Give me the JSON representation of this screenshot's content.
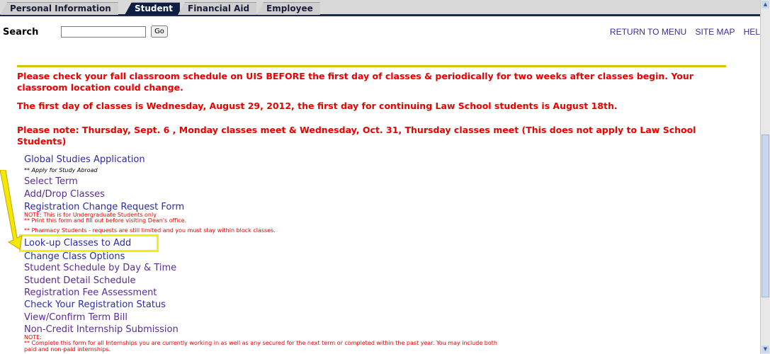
{
  "tabs": [
    {
      "label": "Personal Information",
      "active": false
    },
    {
      "label": "Student",
      "active": true
    },
    {
      "label": "Financial Aid",
      "active": false
    },
    {
      "label": "Employee",
      "active": false
    }
  ],
  "search": {
    "label": "Search",
    "value": "",
    "go_label": "Go"
  },
  "top_links": [
    "RETURN TO MENU",
    "SITE MAP",
    "HELP"
  ],
  "notices": [
    "Please check your fall classroom schedule on UIS BEFORE the first day of classes & periodically for two weeks after classes begin. Your classroom location could change.",
    "The first day of classes is Wednesday, August 29, 2012, the first day for continuing Law School students is August 18th.",
    "Please note: Thursday, Sept. 6 , Monday classes meet & Wednesday, Oct. 31, Thursday classes meet (This does not apply to Law School Students)"
  ],
  "menu": {
    "global_studies": "Global Studies Application",
    "global_studies_note": "** Apply for Study Abroad",
    "select_term": "Select Term",
    "add_drop": "Add/Drop Classes",
    "reg_change": "Registration Change Request Form",
    "reg_change_note1": "NOTE: This is for Undergraduate Students only",
    "reg_change_note2": "** Print this form and fill out before visiting Dean's office.",
    "reg_change_note3": "** Pharmacy Students - requests are still limited and you must stay within block classes.",
    "lookup_classes": "Look-up Classes to Add",
    "change_class_options": "Change Class Options",
    "schedule_day_time": "Student Schedule by Day & Time",
    "detail_schedule": "Student Detail Schedule",
    "fee_assessment": "Registration Fee Assessment",
    "reg_status": "Check Your Registration Status",
    "term_bill": "View/Confirm Term Bill",
    "internship": "Non-Credit Internship Submission",
    "internship_note1": "NOTE:",
    "internship_note2": "** Complete this form for all Internships you are currently working in as well as any secured for the next term or completed within the past year. You may include both",
    "internship_note3": "paid and non-paid internships."
  },
  "colors": {
    "highlight": "#f2f200",
    "notice_red": "#ee0000",
    "link": "#2b2bab",
    "tab_active": "#0f1f44"
  }
}
